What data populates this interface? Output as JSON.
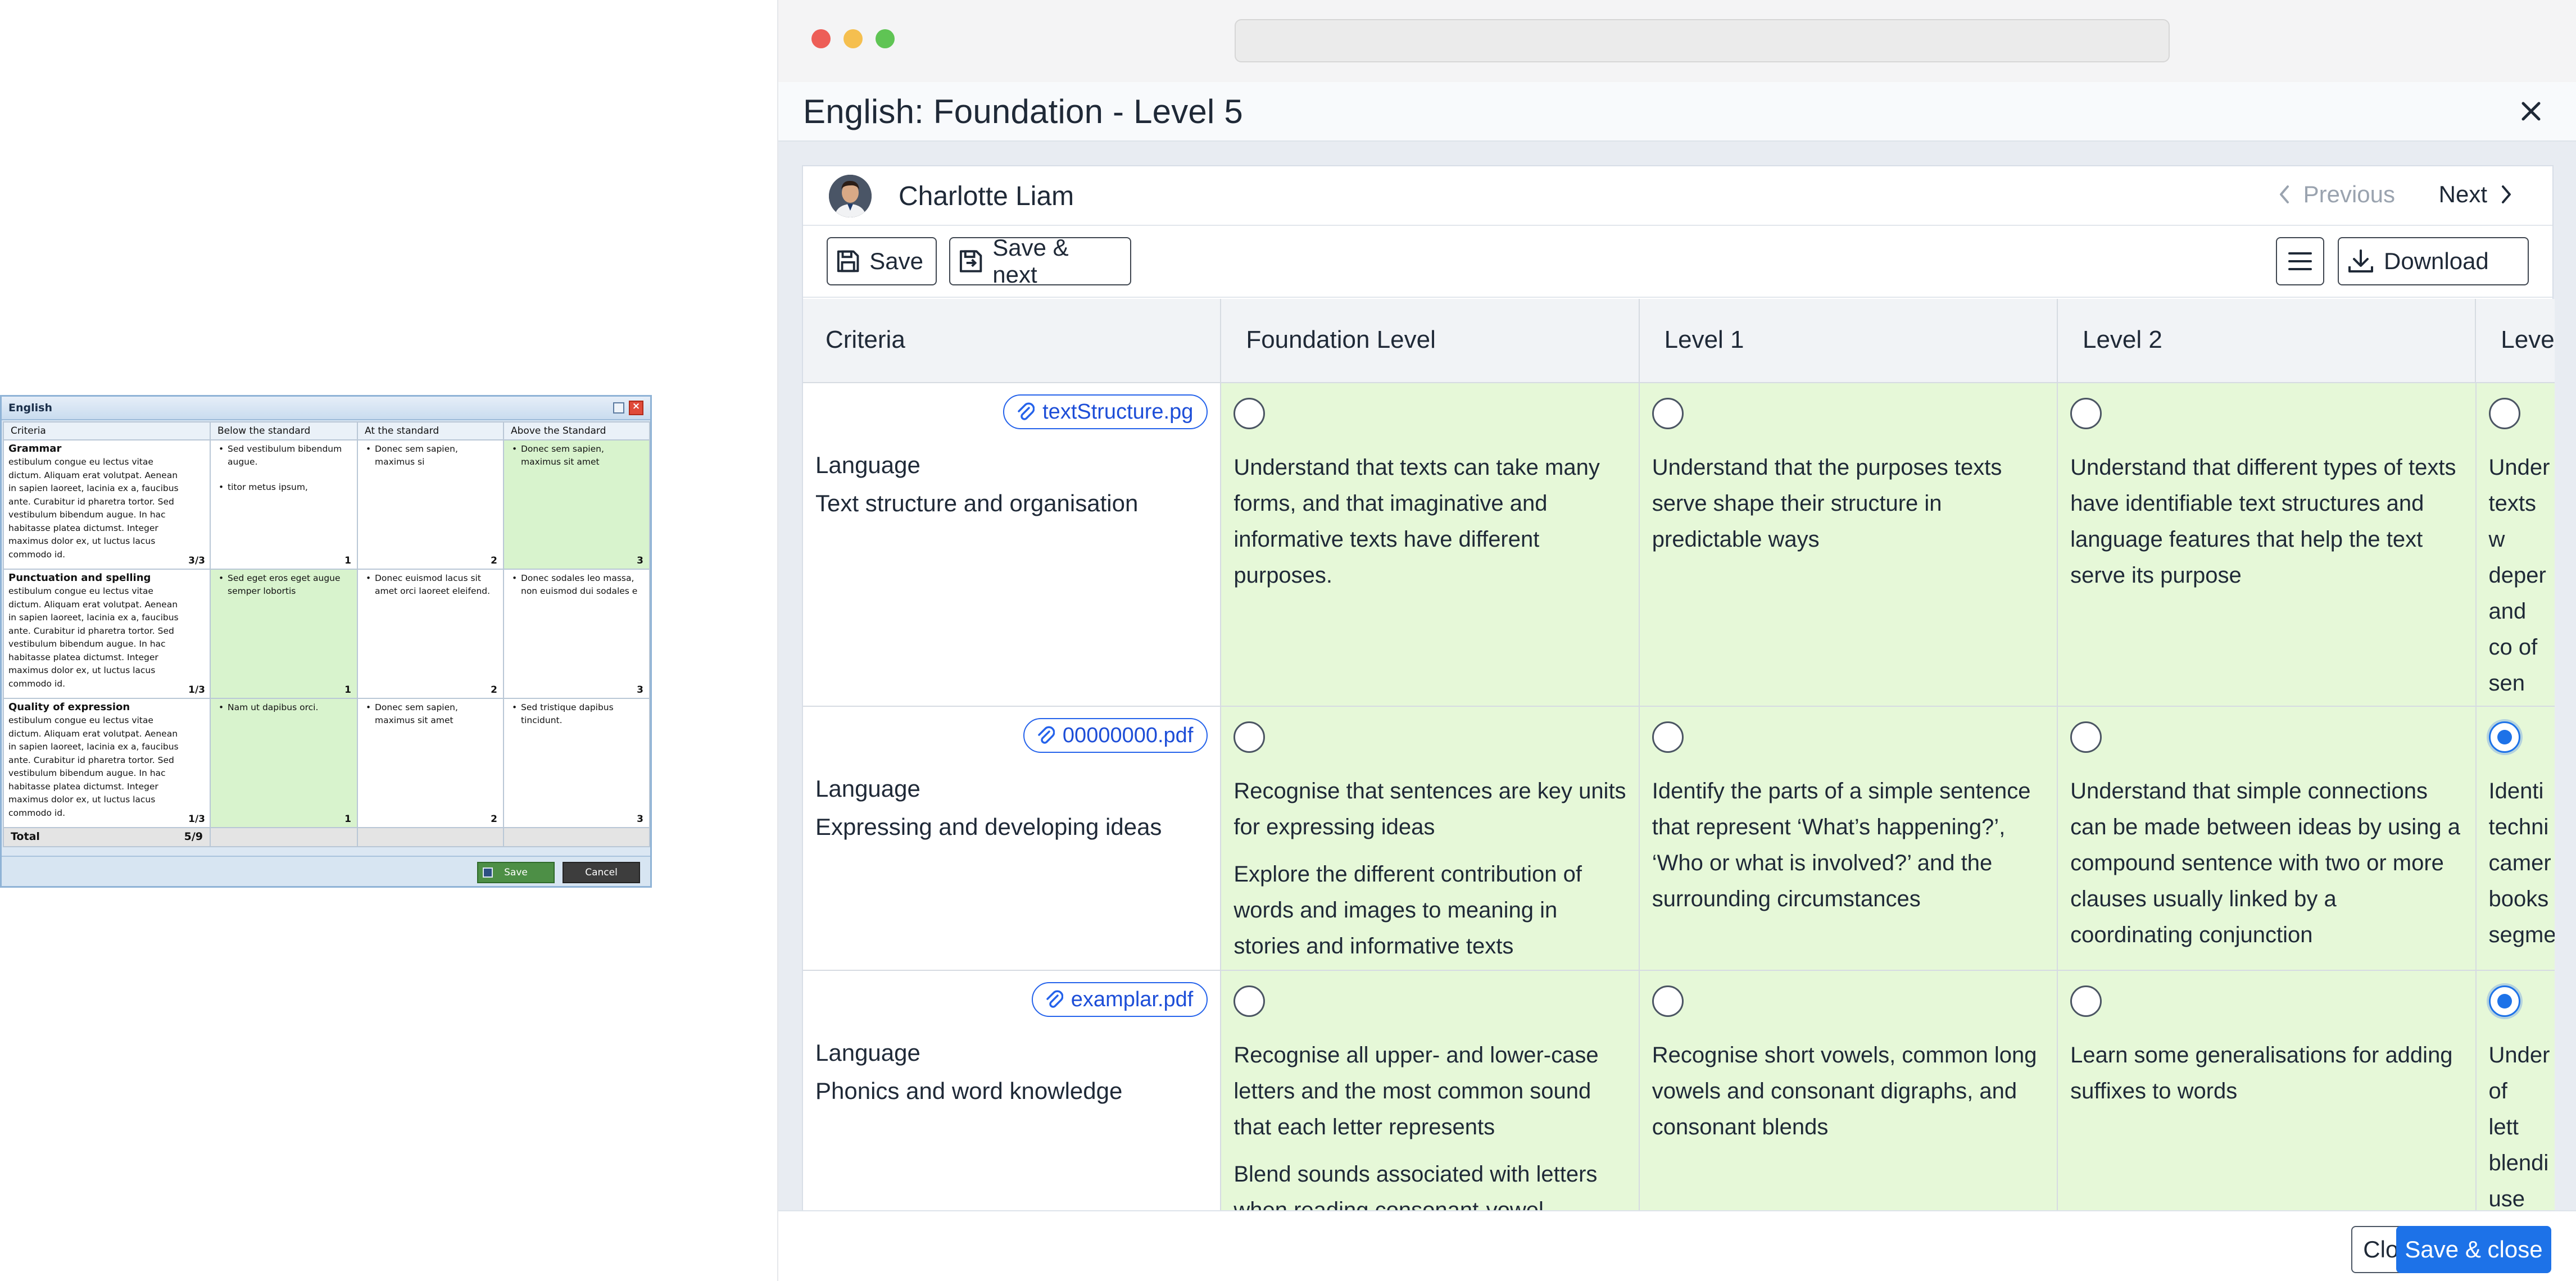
{
  "legacy_window": {
    "title": "English",
    "headers": [
      "Criteria",
      "Below the standard",
      "At the standard",
      "Above the Standard"
    ],
    "rows": [
      {
        "title": "Grammar",
        "desc": "estibulum congue eu lectus vitae dictum. Aliquam erat volutpat. Aenean in sapien laoreet, lacinia ex a, faucibus ante. Curabitur id pharetra tortor. Sed vestibulum bibendum augue. In hac habitasse platea dictumst. Integer maximus dolor ex, ut luctus lacus commodo id.",
        "score": "3/3",
        "cells": [
          {
            "items": [
              "Sed vestibulum bibendum augue.",
              "titor metus ipsum,"
            ],
            "num": "1",
            "selected": false
          },
          {
            "items": [
              "Donec sem sapien, maximus si"
            ],
            "num": "2",
            "selected": false
          },
          {
            "items": [
              "Donec sem sapien, maximus sit amet"
            ],
            "num": "3",
            "selected": true
          }
        ]
      },
      {
        "title": "Punctuation and spelling",
        "desc": "estibulum congue eu lectus vitae dictum. Aliquam erat volutpat. Aenean in sapien laoreet, lacinia ex a, faucibus ante. Curabitur id pharetra tortor. Sed vestibulum bibendum augue. In hac habitasse platea dictumst. Integer maximus dolor ex, ut luctus lacus commodo id.",
        "score": "1/3",
        "cells": [
          {
            "items": [
              "Sed eget eros eget augue semper lobortis"
            ],
            "num": "1",
            "selected": true
          },
          {
            "items": [
              "Donec euismod lacus sit amet orci laoreet eleifend."
            ],
            "num": "2",
            "selected": false
          },
          {
            "items": [
              "Donec sodales leo massa, non euismod dui sodales e"
            ],
            "num": "3",
            "selected": false
          }
        ]
      },
      {
        "title": "Quality of expression",
        "desc": "estibulum congue eu lectus vitae dictum. Aliquam erat volutpat. Aenean in sapien laoreet, lacinia ex a, faucibus ante. Curabitur id pharetra tortor. Sed vestibulum bibendum augue. In hac habitasse platea dictumst. Integer maximus dolor ex, ut luctus lacus commodo id.",
        "score": "1/3",
        "cells": [
          {
            "items": [
              "Nam ut dapibus orci."
            ],
            "num": "1",
            "selected": true
          },
          {
            "items": [
              "Donec sem sapien, maximus sit amet"
            ],
            "num": "2",
            "selected": false
          },
          {
            "items": [
              "Sed tristique dapibus tincidunt."
            ],
            "num": "3",
            "selected": false
          }
        ]
      }
    ],
    "total_label": "Total",
    "total_value": "5/9",
    "save_label": "Save",
    "cancel_label": "Cancel"
  },
  "modal": {
    "title": "English: Foundation - Level 5",
    "student_name": "Charlotte Liam",
    "previous_label": "Previous",
    "next_label": "Next",
    "save_label": "Save",
    "save_next_label": "Save & next",
    "download_label": "Download",
    "close_label": "Close",
    "save_close_label": "Save & close",
    "columns": [
      "Criteria",
      "Foundation Level",
      "Level 1",
      "Level 2",
      "Leve"
    ],
    "rows": [
      {
        "attachment": "textStructure.pg",
        "area": "Language",
        "criterion": "Text structure and organisation",
        "levels": [
          {
            "texts": [
              "Understand that texts can take many forms, and that imaginative and informative texts have different purposes."
            ],
            "selected": false
          },
          {
            "texts": [
              "Understand that the purposes texts serve shape their structure in predictable ways"
            ],
            "selected": false
          },
          {
            "texts": [
              "Understand that different types of texts have identifiable text structures and language features that help the text serve its purpose"
            ],
            "selected": false
          },
          {
            "texts": [
              "Under texts w deper and co of sen"
            ],
            "selected": false
          }
        ]
      },
      {
        "attachment": "00000000.pdf",
        "area": "Language",
        "criterion": "Expressing and developing ideas",
        "levels": [
          {
            "texts": [
              "Recognise that sentences are key units for expressing ideas",
              "Explore the different contribution of words and images to meaning in stories and informative texts"
            ],
            "selected": false
          },
          {
            "texts": [
              "Identify the parts of a simple sentence that represent ‘What’s happening?’, ‘Who or what is involved?’ and the surrounding circumstances"
            ],
            "selected": false
          },
          {
            "texts": [
              "Understand that simple connections can be made between ideas by using a compound sentence with two or more clauses usually linked by a coordinating conjunction"
            ],
            "selected": false
          },
          {
            "texts": [
              "Identi techni camer books segme"
            ],
            "selected": true
          }
        ]
      },
      {
        "attachment": "examplar.pdf",
        "area": "Language",
        "criterion": "Phonics and word knowledge",
        "levels": [
          {
            "texts": [
              "Recognise all upper- and lower-case letters and the most common sound that each letter represents",
              "Blend sounds associated with letters when reading consonant-vowel"
            ],
            "selected": false
          },
          {
            "texts": [
              "Recognise short vowels, common long vowels and consonant digraphs, and consonant blends"
            ],
            "selected": false
          },
          {
            "texts": [
              "Learn some generalisations for adding suffixes to words"
            ],
            "selected": false
          },
          {
            "texts": [
              "Under of lett blendi use m comm"
            ],
            "selected": true
          }
        ]
      }
    ]
  },
  "colors": {
    "selected_level_bg": "#e6f8d8",
    "primary": "#1d72e8",
    "legacy_selected": "#d8f3cd"
  }
}
